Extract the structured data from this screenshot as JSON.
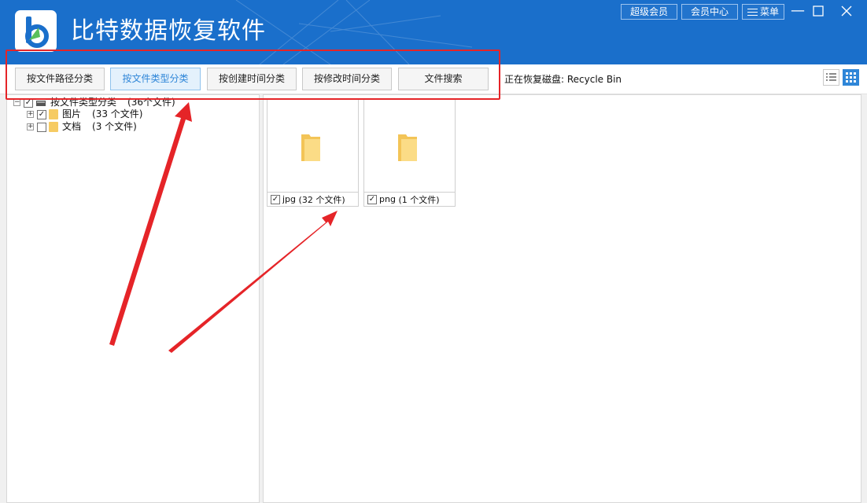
{
  "app": {
    "title": "比特数据恢复软件",
    "brand_color": "#1a6fcb"
  },
  "header": {
    "buttons": [
      {
        "label": "超级会员"
      },
      {
        "label": "会员中心"
      },
      {
        "label": "菜单"
      }
    ],
    "window_controls": [
      "minimize-icon",
      "maximize-icon",
      "close-icon"
    ]
  },
  "tabs": [
    {
      "label": "按文件路径分类",
      "active": false
    },
    {
      "label": "按文件类型分类",
      "active": true
    },
    {
      "label": "按创建时间分类",
      "active": false
    },
    {
      "label": "按修改时间分类",
      "active": false
    },
    {
      "label": "文件搜索",
      "active": false
    }
  ],
  "status": {
    "text": "正在恢复磁盘: Recycle Bin"
  },
  "view_toggle": {
    "options": [
      "list-view-icon",
      "grid-view-icon"
    ],
    "active": "grid-view-icon"
  },
  "tree": {
    "root": {
      "label": "按文件类型分类",
      "count": "(36个文件)",
      "checked": true
    },
    "children": [
      {
        "label": "图片",
        "count": "(33 个文件)",
        "checked": true
      },
      {
        "label": "文档",
        "count": "(3 个文件)",
        "checked": false
      }
    ]
  },
  "tiles": [
    {
      "label": "jpg",
      "count": "(32 个文件)",
      "checked": true
    },
    {
      "label": "png",
      "count": "(1 个文件)",
      "checked": true
    }
  ],
  "annotation_color": "#e52428"
}
